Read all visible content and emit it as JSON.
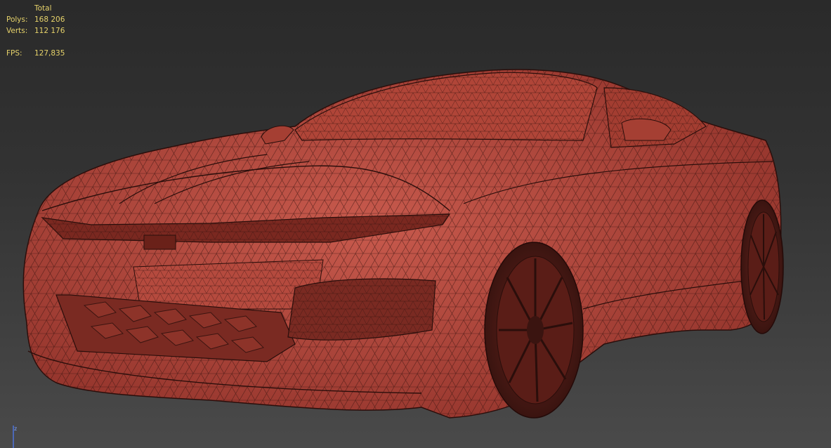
{
  "stats": {
    "header": "Total",
    "polys_label": "Polys:",
    "polys_value": "168 206",
    "verts_label": "Verts:",
    "verts_value": "112 176",
    "fps_label": "FPS:",
    "fps_value": "127,835"
  },
  "gizmo": {
    "axis_label": "z"
  },
  "colors": {
    "stats_text": "#e6d26a",
    "mesh_fill": "#b5493f",
    "mesh_wire": "#3a1410"
  },
  "icons": [
    "axis-gizmo-icon"
  ]
}
